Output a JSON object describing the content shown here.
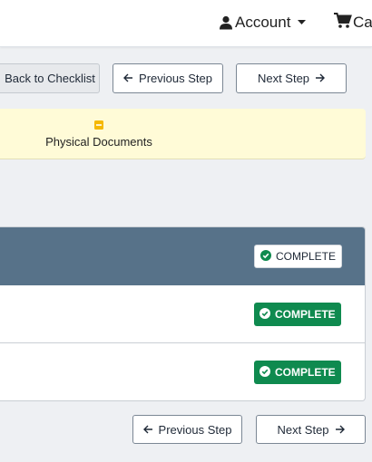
{
  "header": {
    "account_label": "Account",
    "cart_label": "Car"
  },
  "nav_top": {
    "back_label": "Back to Checklist",
    "prev_label": "Previous Step",
    "next_label": "Next Step"
  },
  "notice": {
    "label": "Physical Documents",
    "icon_color": "#f5b800"
  },
  "panel": {
    "rows": [
      {
        "status": "COMPLETE"
      },
      {
        "status": "COMPLETE"
      },
      {
        "status": "COMPLETE"
      }
    ]
  },
  "nav_bottom": {
    "prev_label": "Previous Step",
    "next_label": "Next Step"
  },
  "colors": {
    "header_bar": "#577289",
    "complete_green": "#0f8a4f",
    "notice_bg": "#fffbd7"
  }
}
